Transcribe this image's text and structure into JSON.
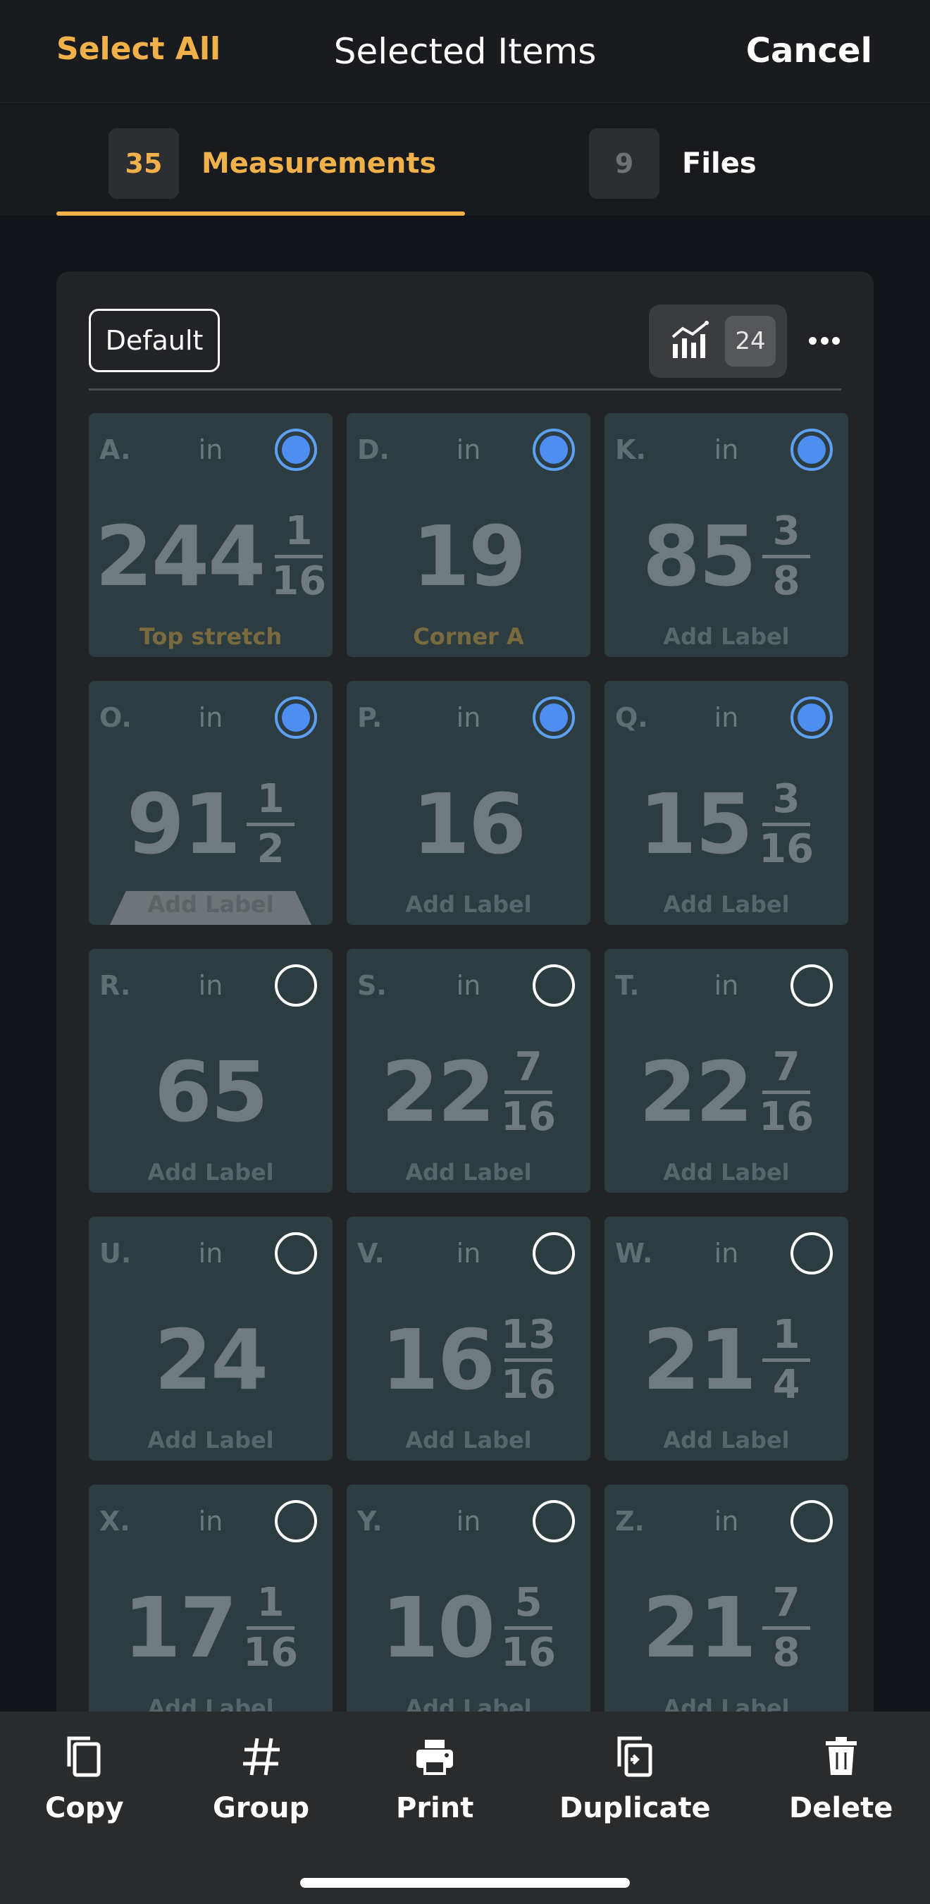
{
  "header": {
    "select_all": "Select All",
    "title": "Selected Items",
    "cancel": "Cancel"
  },
  "tabs": [
    {
      "count": "35",
      "label": "Measurements",
      "active": true
    },
    {
      "count": "9",
      "label": "Files",
      "active": false
    }
  ],
  "toolbar": {
    "default_label": "Default",
    "stats_count": "24",
    "stats_icon": "bar-chart-trend-icon",
    "more_icon": "more-horizontal-icon"
  },
  "measurements": [
    {
      "letter": "A.",
      "unit": "in",
      "whole": "244",
      "num": "1",
      "den": "16",
      "label": "Top stretch",
      "selected": true
    },
    {
      "letter": "D.",
      "unit": "in",
      "whole": "19",
      "num": "",
      "den": "",
      "label": "Corner A",
      "selected": true
    },
    {
      "letter": "K.",
      "unit": "in",
      "whole": "85",
      "num": "3",
      "den": "8",
      "label": "Add Label",
      "selected": true
    },
    {
      "letter": "O.",
      "unit": "in",
      "whole": "91",
      "num": "1",
      "den": "2",
      "label": "Add Label",
      "selected": true
    },
    {
      "letter": "P.",
      "unit": "in",
      "whole": "16",
      "num": "",
      "den": "",
      "label": "Add Label",
      "selected": true
    },
    {
      "letter": "Q.",
      "unit": "in",
      "whole": "15",
      "num": "3",
      "den": "16",
      "label": "Add Label",
      "selected": true
    },
    {
      "letter": "R.",
      "unit": "in",
      "whole": "65",
      "num": "",
      "den": "",
      "label": "Add Label",
      "selected": false
    },
    {
      "letter": "S.",
      "unit": "in",
      "whole": "22",
      "num": "7",
      "den": "16",
      "label": "Add Label",
      "selected": false
    },
    {
      "letter": "T.",
      "unit": "in",
      "whole": "22",
      "num": "7",
      "den": "16",
      "label": "Add Label",
      "selected": false
    },
    {
      "letter": "U.",
      "unit": "in",
      "whole": "24",
      "num": "",
      "den": "",
      "label": "Add Label",
      "selected": false
    },
    {
      "letter": "V.",
      "unit": "in",
      "whole": "16",
      "num": "13",
      "den": "16",
      "label": "Add Label",
      "selected": false
    },
    {
      "letter": "W.",
      "unit": "in",
      "whole": "21",
      "num": "1",
      "den": "4",
      "label": "Add Label",
      "selected": false
    },
    {
      "letter": "X.",
      "unit": "in",
      "whole": "17",
      "num": "1",
      "den": "16",
      "label": "Add Label",
      "selected": false
    },
    {
      "letter": "Y.",
      "unit": "in",
      "whole": "10",
      "num": "5",
      "den": "16",
      "label": "Add Label",
      "selected": false
    },
    {
      "letter": "Z.",
      "unit": "in",
      "whole": "21",
      "num": "7",
      "den": "8",
      "label": "Add Label",
      "selected": false
    }
  ],
  "actions": [
    {
      "label": "Copy",
      "icon": "copy-icon"
    },
    {
      "label": "Group",
      "icon": "hash-icon"
    },
    {
      "label": "Print",
      "icon": "printer-icon"
    },
    {
      "label": "Duplicate",
      "icon": "duplicate-icon"
    },
    {
      "label": "Delete",
      "icon": "trash-icon"
    }
  ]
}
